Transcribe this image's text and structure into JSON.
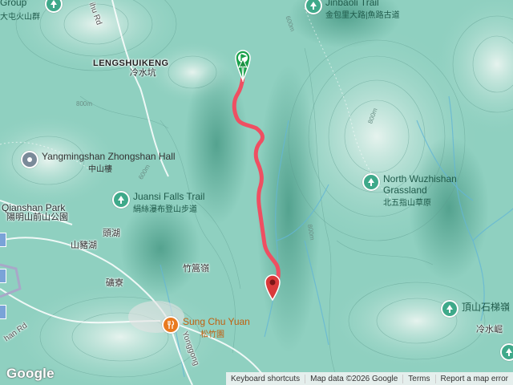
{
  "map": {
    "colors": {
      "terrain": "#8fd0c0",
      "trail": "#ef4f62",
      "park": "#3fa98a",
      "restaurant": "#e97a1f",
      "pin_start": "#1aa14b",
      "pin_end": "#d93a3a"
    },
    "place_labels": {
      "lengshuikeng_en": "LENGSHUIKENG",
      "lengshuikeng_zh": "冷水坑",
      "toutang_zh": "頭湖",
      "shanzhuhu_zh": "山豬湖",
      "zhuxiaoling_zh": "竹篙嶺",
      "kuangliao_zh": "礦寮",
      "lengshuijue_zh": "冷水崛",
      "qianshan_park_en": "Qianshan Park",
      "qianshan_park_zh": "陽明山前山公園",
      "top_left_partial": "Group",
      "top_left_partial_zh": "大屯火山群",
      "bottom_left_partial": "han Rd",
      "road_right_top": "ihu Rd",
      "road_bottom": "Yonggong"
    },
    "pois": {
      "zhongshan_hall_en": "Yangmingshan Zhongshan Hall",
      "zhongshan_hall_zh": "中山樓",
      "juansi_en": "Juansi Falls Trail",
      "juansi_zh": "絹絲瀑布登山步道",
      "jinbaoli_en": "Jinbaoli Trail",
      "jinbaoli_zh": "金包里大路|魚路古道",
      "wuzhishan_en": "North Wuzhishan Grassland",
      "wuzhishan_zh": "北五指山草原",
      "sungchuyuan_en": "Sung Chu Yuan",
      "sungchuyuan_zh": "松竹園",
      "dingshan_zh": "頂山石梯嶺"
    },
    "contour_labels": [
      "600m",
      "800m",
      "800m",
      "600m",
      "800m"
    ],
    "icons": [
      "park-icon",
      "restaurant-icon",
      "route-start-pin",
      "route-end-pin"
    ]
  },
  "footer": {
    "logo": "Google",
    "keyboard": "Keyboard shortcuts",
    "map_data": "Map data ©2026 Google",
    "terms": "Terms",
    "report": "Report a map error"
  }
}
